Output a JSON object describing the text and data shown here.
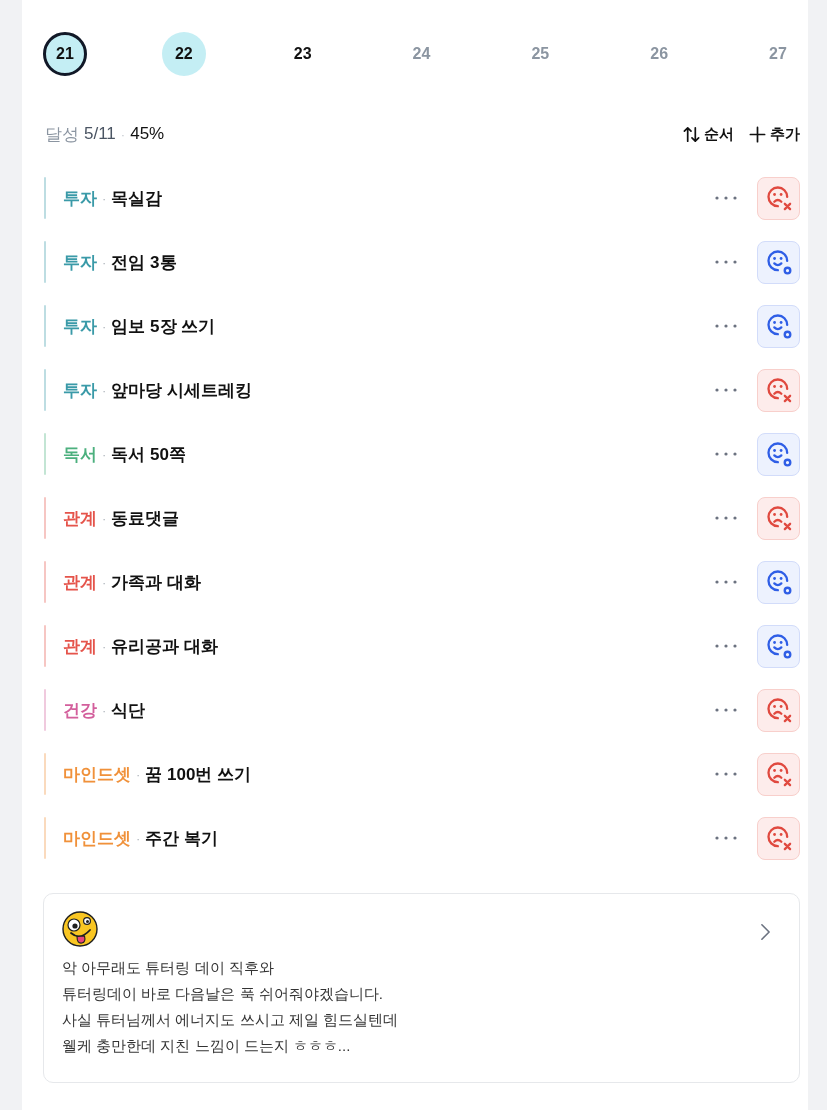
{
  "date_strip": {
    "days": [
      {
        "label": "21",
        "selected": true,
        "marked": true,
        "disabled": false
      },
      {
        "label": "22",
        "selected": false,
        "marked": true,
        "disabled": false
      },
      {
        "label": "23",
        "selected": false,
        "marked": false,
        "disabled": false
      },
      {
        "label": "24",
        "selected": false,
        "marked": false,
        "disabled": true
      },
      {
        "label": "25",
        "selected": false,
        "marked": false,
        "disabled": true
      },
      {
        "label": "26",
        "selected": false,
        "marked": false,
        "disabled": true
      },
      {
        "label": "27",
        "selected": false,
        "marked": false,
        "disabled": true
      }
    ]
  },
  "summary": {
    "label": "달성",
    "count": "5/11",
    "separator": "·",
    "percent": "45%"
  },
  "actions": [
    {
      "kind": "sort",
      "label": "순서"
    },
    {
      "kind": "add",
      "label": "추가"
    }
  ],
  "tasks": [
    {
      "category": "투자",
      "color": "#3a9aa8",
      "separator": "·",
      "title": "목실감",
      "achieved": false
    },
    {
      "category": "투자",
      "color": "#3a9aa8",
      "separator": "·",
      "title": "전임 3통",
      "achieved": true
    },
    {
      "category": "투자",
      "color": "#3a9aa8",
      "separator": "·",
      "title": "임보 5장 쓰기",
      "achieved": true
    },
    {
      "category": "투자",
      "color": "#3a9aa8",
      "separator": "·",
      "title": "앞마당 시세트레킹",
      "achieved": false
    },
    {
      "category": "독서",
      "color": "#4cb07e",
      "separator": "·",
      "title": "독서 50쪽",
      "achieved": true
    },
    {
      "category": "관계",
      "color": "#e5544b",
      "separator": "·",
      "title": "동료댓글",
      "achieved": false
    },
    {
      "category": "관계",
      "color": "#e5544b",
      "separator": "·",
      "title": "가족과 대화",
      "achieved": true
    },
    {
      "category": "관계",
      "color": "#e5544b",
      "separator": "·",
      "title": "유리공과 대화",
      "achieved": true
    },
    {
      "category": "건강",
      "color": "#d35f9c",
      "separator": "·",
      "title": "식단",
      "achieved": false
    },
    {
      "category": "마인드셋",
      "color": "#f0913a",
      "separator": "·",
      "title": "꿈 100번 쓰기",
      "achieved": false
    },
    {
      "category": "마인드셋",
      "color": "#f0913a",
      "separator": "·",
      "title": "주간 복기",
      "achieved": false
    }
  ],
  "note": {
    "text": "악 아무래도 튜터링 데이 직후와\n튜터링데이 바로 다음날은 푹 쉬어줘야겠습니다.\n사실 튜터님께서 에너지도 쓰시고 제일 힘드실텐데\n웰케 충만한데 지친 느낌이 드는지 ㅎㅎㅎ..."
  }
}
